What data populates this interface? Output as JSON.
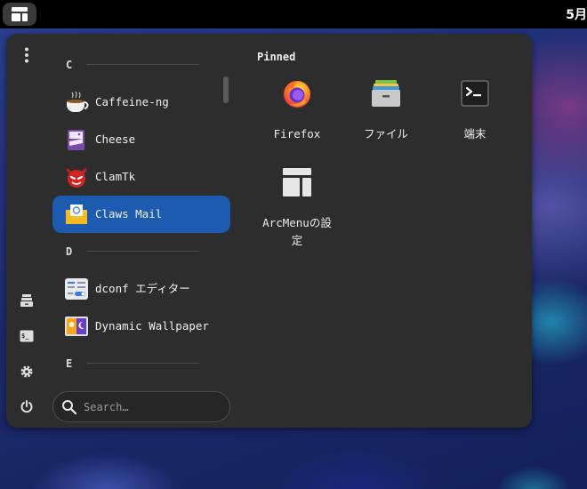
{
  "topbar": {
    "clock_text": "5月"
  },
  "sidebar_icons": [
    {
      "name": "menu-dots-icon"
    },
    {
      "name": "file-cabinet-icon"
    },
    {
      "name": "terminal-icon"
    },
    {
      "name": "settings-icon"
    },
    {
      "name": "power-icon"
    }
  ],
  "app_list": {
    "sections": [
      {
        "letter": "C"
      },
      {
        "letter": "D"
      },
      {
        "letter": "E"
      }
    ],
    "apps": [
      {
        "label": "Caffeine-ng",
        "icon": "coffee-cup-icon"
      },
      {
        "label": "Cheese",
        "icon": "cheese-icon"
      },
      {
        "label": "ClamTk",
        "icon": "clamtk-icon"
      },
      {
        "label": "Claws Mail",
        "icon": "mail-envelope-icon",
        "selected": true
      },
      {
        "label": "dconf エディター",
        "icon": "dconf-icon"
      },
      {
        "label": "Dynamic Wallpaper",
        "icon": "dynamic-wallpaper-icon"
      }
    ]
  },
  "search": {
    "placeholder": "Search…"
  },
  "pinned": {
    "title": "Pinned",
    "items": [
      {
        "label": "Firefox",
        "icon": "firefox-icon"
      },
      {
        "label": "ファイル",
        "icon": "file-cabinet-icon"
      },
      {
        "label": "端末",
        "icon": "terminal-icon"
      },
      {
        "label_line1": "ArcMenuの設",
        "label_line2": "定",
        "icon": "arcmenu-settings-icon"
      }
    ]
  }
}
